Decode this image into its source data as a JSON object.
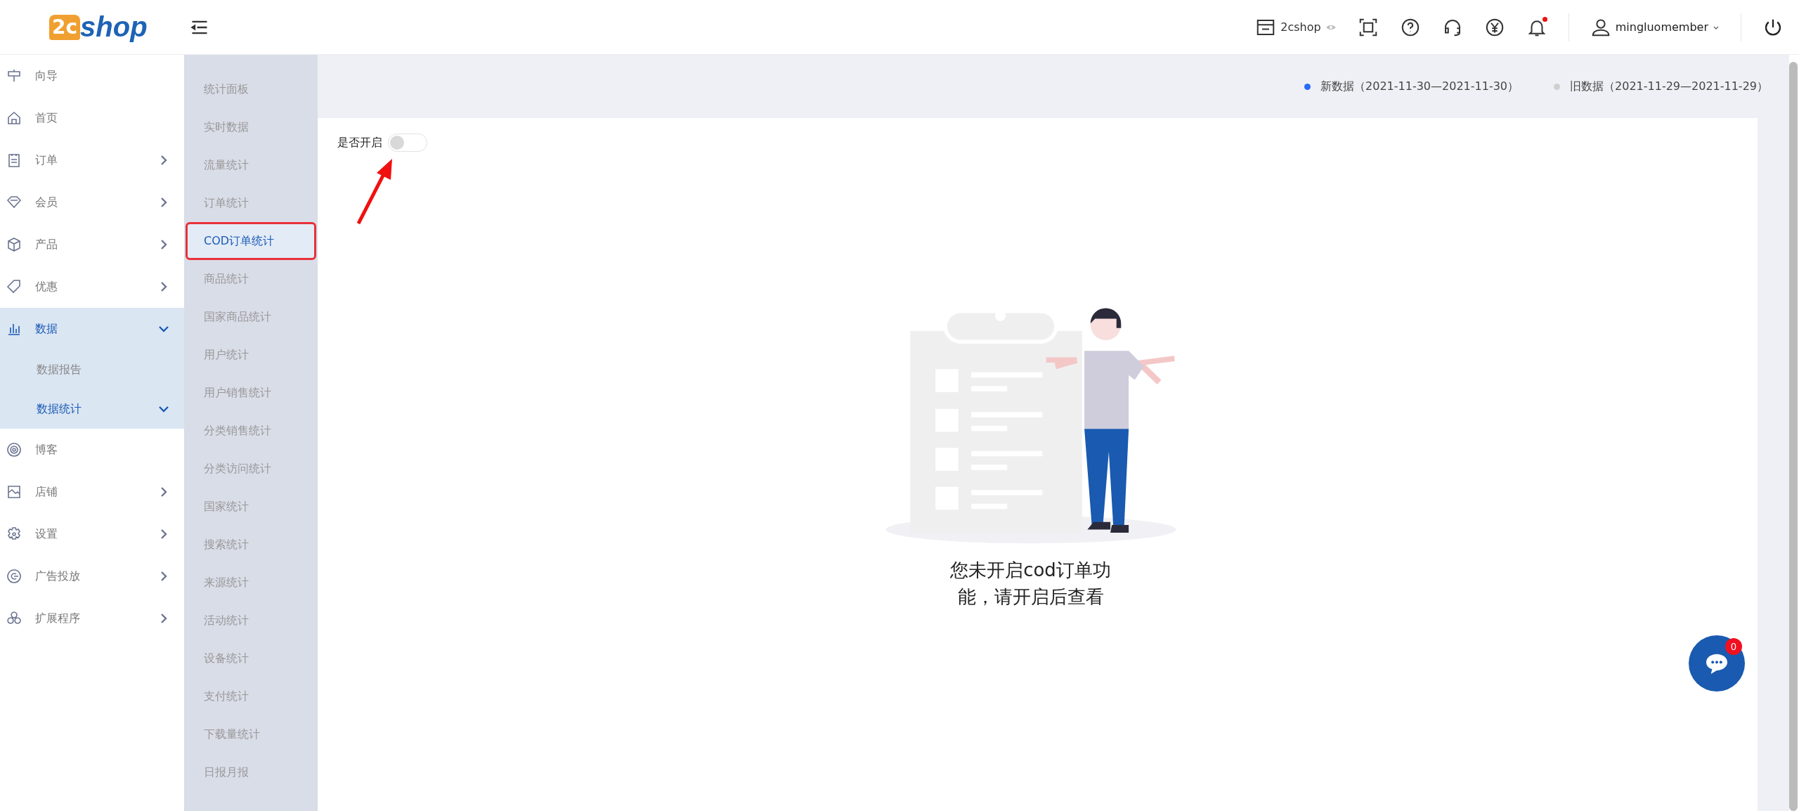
{
  "header": {
    "logo": {
      "badge": "2c",
      "word": "shop"
    },
    "store": "2cshop",
    "notifications": {
      "unread": true
    },
    "user": "mingluomember"
  },
  "nav": [
    {
      "label": "向导",
      "kind": "link",
      "selected": false
    },
    {
      "label": "首页",
      "kind": "link",
      "selected": false
    },
    {
      "label": "订单",
      "kind": "submenu",
      "expanded": false,
      "selected": false
    },
    {
      "label": "会员",
      "kind": "submenu",
      "expanded": false,
      "selected": false
    },
    {
      "label": "产品",
      "kind": "submenu",
      "expanded": false,
      "selected": false
    },
    {
      "label": "优惠",
      "kind": "submenu",
      "expanded": false,
      "selected": false
    },
    {
      "label": "数据",
      "kind": "submenu",
      "expanded": true,
      "selected": true,
      "children": [
        {
          "label": "数据报告",
          "kind": "link",
          "selected": false
        },
        {
          "label": "数据统计",
          "kind": "submenu",
          "expanded": true,
          "selected": true
        }
      ]
    },
    {
      "label": "博客",
      "kind": "link",
      "selected": false
    },
    {
      "label": "店铺",
      "kind": "submenu",
      "expanded": false,
      "selected": false
    },
    {
      "label": "设置",
      "kind": "submenu",
      "expanded": false,
      "selected": false
    },
    {
      "label": "广告投放",
      "kind": "submenu",
      "expanded": false,
      "selected": false
    },
    {
      "label": "扩展程序",
      "kind": "submenu",
      "expanded": false,
      "selected": false
    }
  ],
  "submenu": [
    {
      "label": "统计面板",
      "selected": false,
      "highlighted": false
    },
    {
      "label": "实时数据",
      "selected": false,
      "highlighted": false
    },
    {
      "label": "流量统计",
      "selected": false,
      "highlighted": false
    },
    {
      "label": "订单统计",
      "selected": false,
      "highlighted": false
    },
    {
      "label": "COD订单统计",
      "selected": true,
      "highlighted": true
    },
    {
      "label": "商品统计",
      "selected": false,
      "highlighted": false
    },
    {
      "label": "国家商品统计",
      "selected": false,
      "highlighted": false
    },
    {
      "label": "用户统计",
      "selected": false,
      "highlighted": false
    },
    {
      "label": "用户销售统计",
      "selected": false,
      "highlighted": false
    },
    {
      "label": "分类销售统计",
      "selected": false,
      "highlighted": false
    },
    {
      "label": "分类访问统计",
      "selected": false,
      "highlighted": false
    },
    {
      "label": "国家统计",
      "selected": false,
      "highlighted": false
    },
    {
      "label": "搜索统计",
      "selected": false,
      "highlighted": false
    },
    {
      "label": "来源统计",
      "selected": false,
      "highlighted": false
    },
    {
      "label": "活动统计",
      "selected": false,
      "highlighted": false
    },
    {
      "label": "设备统计",
      "selected": false,
      "highlighted": false
    },
    {
      "label": "支付统计",
      "selected": false,
      "highlighted": false
    },
    {
      "label": "下载量统计",
      "selected": false,
      "highlighted": false
    },
    {
      "label": "日报月报",
      "selected": false,
      "highlighted": false
    }
  ],
  "legend": [
    {
      "label": "新数据（2021-11-30—2021-11-30）",
      "color": "#2a6af5"
    },
    {
      "label": "旧数据（2021-11-29—2021-11-29）",
      "color": "#cfcfcf"
    }
  ],
  "toggle": {
    "label": "是否开启",
    "on": false,
    "annotated": true
  },
  "empty_state": {
    "message": "您未开启cod订单功能，请开启后查看"
  },
  "chat": {
    "badge": "0"
  }
}
